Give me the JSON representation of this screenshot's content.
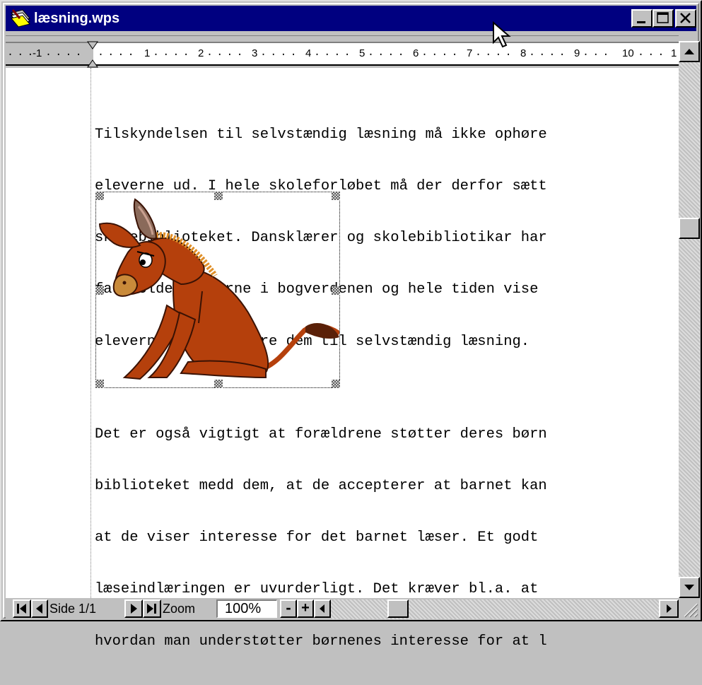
{
  "window": {
    "title": "læsning.wps"
  },
  "ruler": {
    "numbers": [
      "-1",
      "1",
      "2",
      "3",
      "4",
      "5",
      "6",
      "7",
      "8",
      "9",
      "10",
      "1"
    ]
  },
  "document": {
    "paragraph1": [
      "Tilskyndelsen til selvstændig læsning må ikke ophøre",
      "eleverne ud. I hele skoleforløbet må der derfor sætt",
      "skolebiblioteket. Dansklærer og skolebibliotikar har",
      "fastholde eleverne i bogverdenen og hele tiden vise",
      "eleverne og op muntre dem til selvstændig læsning."
    ],
    "paragraph2": [
      "Det er også vigtigt at forældrene støtter deres børn",
      "biblioteket medd dem, at de accepterer at barnet kan",
      "at de viser interesse for det barnet læser. Et godt",
      "læseindlæringen er uvurderligt. Det kræver bl.a. at",
      "hvordan man understøtter børnenes interesse for at l"
    ]
  },
  "statusbar": {
    "page_label": "Side 1/1",
    "zoom_label": "Zoom",
    "zoom_value": "100%",
    "minus": "-",
    "plus": "+"
  },
  "colors": {
    "titlebar": "#000080",
    "face": "#c0c0c0",
    "donkey_body": "#b5400c",
    "donkey_mane": "#e0902a"
  },
  "icons": {
    "app": "wordpad-pen-icon",
    "minimize": "minimize-icon",
    "maximize": "maximize-icon",
    "close": "close-icon"
  }
}
